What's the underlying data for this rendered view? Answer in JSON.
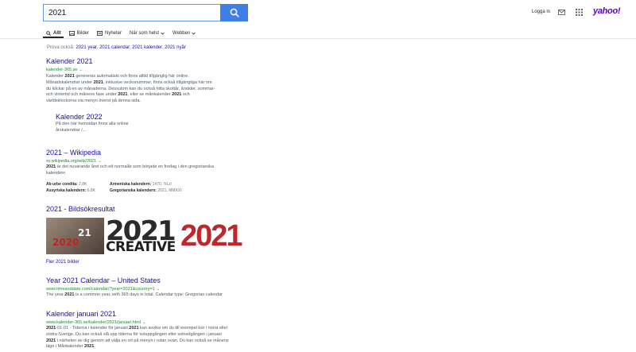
{
  "search": {
    "query": "2021"
  },
  "header": {
    "login_label": "Logga in",
    "logo_text": "yahoo!",
    "brand_color": "#6001d2",
    "accent_color": "#3d7ee8"
  },
  "tabs": [
    {
      "label": "Allt",
      "icon": "search-icon",
      "active": true
    },
    {
      "label": "Bilder",
      "icon": "image-icon"
    },
    {
      "label": "Nyheter",
      "icon": "news-icon"
    },
    {
      "label": "När som helst",
      "icon": "",
      "dropdown": true
    },
    {
      "label": "Webben",
      "icon": "",
      "dropdown": true
    }
  ],
  "also_try": {
    "prefix": "Prova också:",
    "links": [
      "2021 year",
      "2021 calendar",
      "2021 kalender",
      "2021 nyår"
    ]
  },
  "results": [
    {
      "title": "Kalender 2021",
      "url": "kalender-365.se",
      "snippet_lines": [
        [
          "Kalender ",
          "2021",
          " genereras automatiskt och finns alltid tillgänglig här online."
        ],
        [
          "Månadskalendrar under ",
          "2021",
          ", inklusive veckonummer, finns också tillgängliga här om"
        ],
        [
          "du klickar på en av månaderna. Dessutom kan du också hitta skottår, årstider, sommar-"
        ],
        [
          "och vintertid och månens fase under ",
          "2021",
          ", eller se månkalender ",
          "2021",
          " och"
        ],
        [
          "världsklockorna via menyn överst på denna sida."
        ]
      ],
      "sublink": {
        "title": "Kalender 2022",
        "snippet_lines": [
          "På den här hemsidan finns alla online",
          "årskalendrar /..."
        ]
      }
    },
    {
      "title": "2021 – Wikipedia",
      "url": "sv.wikipedia.org/wiki/2021",
      "snippet_lines": [
        [
          "2021",
          " är det nuvarande året och ett normalår som började en fredag i den gregorianska"
        ],
        [
          "kalendern"
        ]
      ],
      "facts": [
        {
          "label": "Ab urbe condita:",
          "value": "2,8K"
        },
        {
          "label": "Armeniska kalendern:",
          "value": "1470, ՌՆԷ"
        },
        {
          "label": "Assyriska kalendern:",
          "value": "6,8K"
        },
        {
          "label": "Gregorianska kalendern:",
          "value": "2021, MMXXI"
        }
      ]
    }
  ],
  "image_section": {
    "title": "2021 - Bildsökresultat",
    "img1_text": {
      "top": "21",
      "bottom": "2020"
    },
    "img2_text": {
      "big": "2021",
      "word": "CREATIVE"
    },
    "img3_text": "2021",
    "more_label": "Fler 2021 bilder"
  },
  "results_after": [
    {
      "title": "Year 2021 Calendar – United States",
      "url": "www.timeanddate.com/calendar/?year=2021&country=1",
      "snippet_lines": [
        [
          "The year ",
          "2021",
          " is a common year, with 365 days in total. Calendar type: Gregorian calendar"
        ]
      ]
    },
    {
      "title": "Kalender januari 2021",
      "url": "www.kalender-365.se/kalender/2021/januari.html",
      "snippet_lines": [
        [
          "2021",
          "-01-01 · Tiderna i kalender för januari ",
          "2021",
          " kan avvika om du till exempel bor i norra eller"
        ],
        [
          "södra Sverige. Du kan också slå upp tiderna för soluppgången eller solnedgången i januari"
        ],
        [
          "2021",
          " i närheten av dig genom att välja en ort på menyn i rutan ovan. Du kan också se månens"
        ],
        [
          "läge i Månkalender ",
          "2021",
          "."
        ]
      ]
    }
  ]
}
